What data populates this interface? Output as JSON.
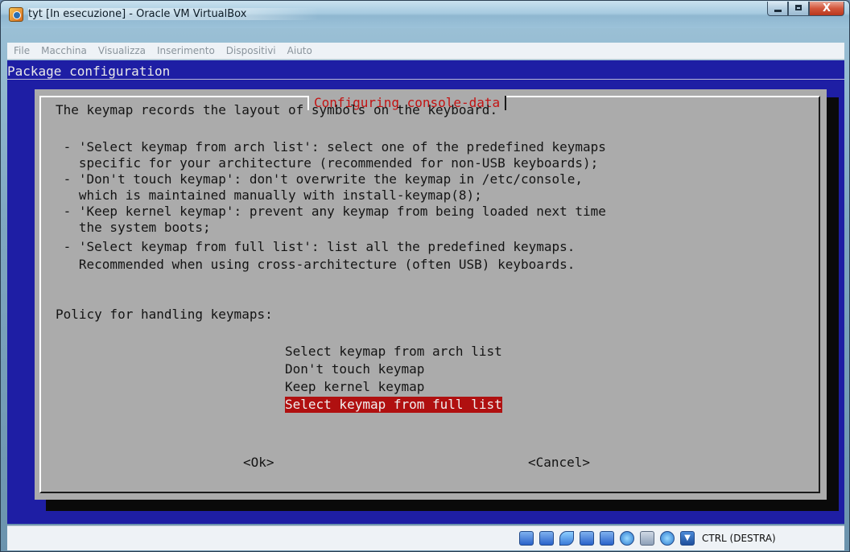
{
  "window": {
    "title": "tyt [In esecuzione] - Oracle VM VirtualBox",
    "close_glyph": "X"
  },
  "menu": [
    "File",
    "Macchina",
    "Visualizza",
    "Inserimento",
    "Dispositivi",
    "Aiuto"
  ],
  "guest": {
    "header": "Package configuration",
    "dialog_title": "Configuring console-data",
    "description": [
      "The keymap records the layout of symbols on the keyboard.",
      "",
      " - 'Select keymap from arch list': select one of the predefined keymaps",
      "   specific for your architecture (recommended for non-USB keyboards);",
      " - 'Don't touch keymap': don't overwrite the keymap in /etc/console,",
      "   which is maintained manually with install-keymap(8);",
      " - 'Keep kernel keymap': prevent any keymap from being loaded next time",
      "   the system boots;",
      " - 'Select keymap from full list': list all the predefined keymaps.",
      "   Recommended when using cross-architecture (often USB) keyboards.",
      "",
      "Policy for handling keymaps:"
    ],
    "choices": [
      "Select keymap from arch list",
      "Don't touch keymap",
      "Keep kernel keymap",
      "Select keymap from full list"
    ],
    "selected_choice": "Select keymap from full list",
    "ok_button": "<Ok>",
    "cancel_button": "<Cancel>"
  },
  "statusbar": {
    "icons": [
      "help-icon",
      "usb-icon",
      "pen-icon",
      "folder-icon",
      "monitor-icon",
      "network-icon",
      "disk-icon",
      "cd-icon",
      "arrow-down-icon"
    ],
    "host_key": "CTRL (DESTRA)"
  },
  "colors": {
    "guest_background": "#1e1ea4",
    "dialog_background": "#ababab",
    "dialog_title": "#c31313",
    "selection": "#b01010"
  }
}
